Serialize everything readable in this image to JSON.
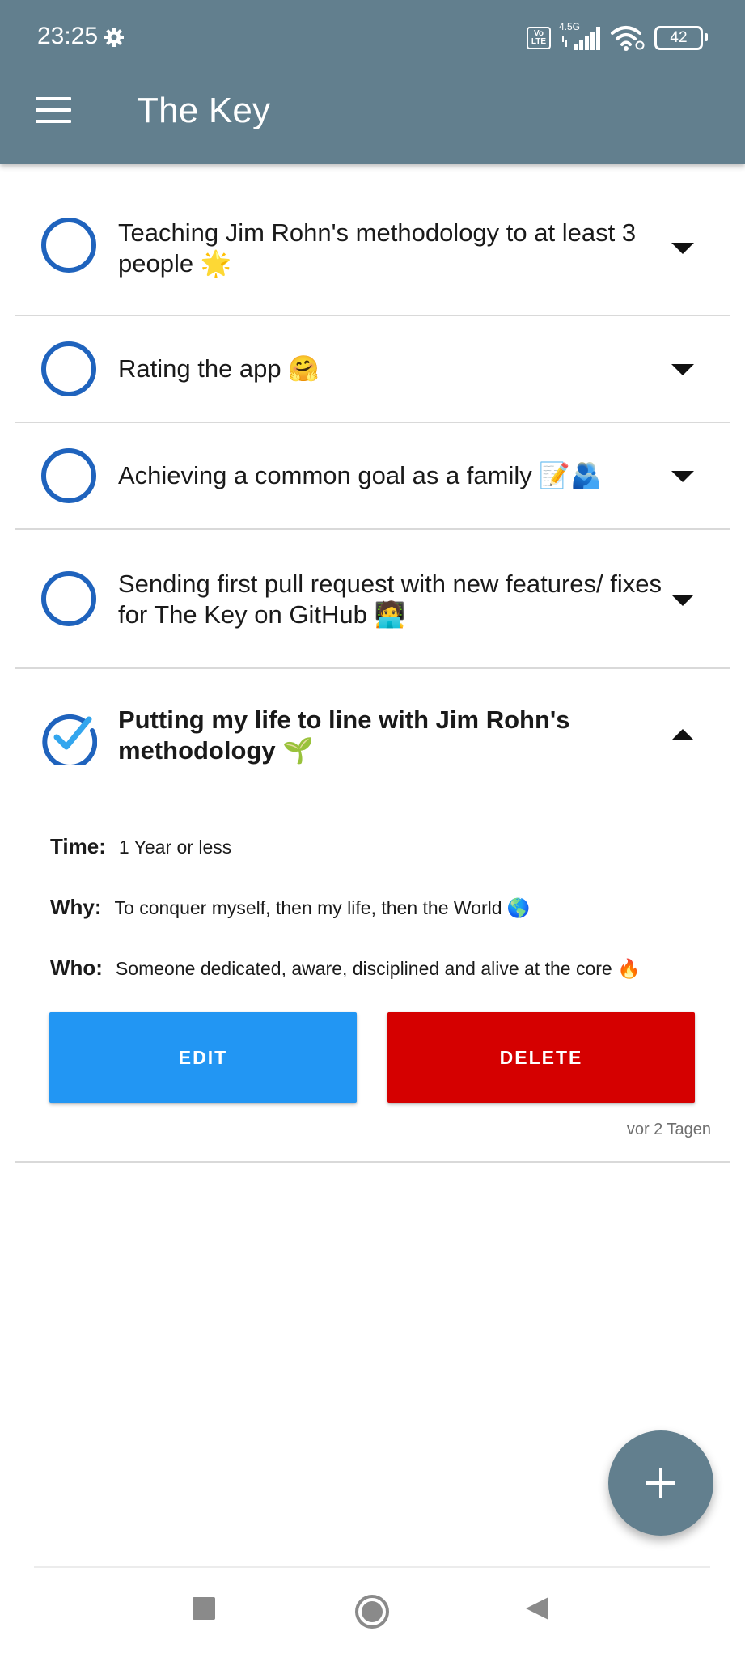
{
  "status_bar": {
    "time": "23:25",
    "network": "4.5G",
    "volte": "Vo LTE",
    "battery": "42"
  },
  "app_bar": {
    "title": "The Key"
  },
  "goals": [
    {
      "text": "Teaching Jim Rohn's methodology to at least 3 people 🌟",
      "checked": false,
      "expanded": false
    },
    {
      "text": "Rating the app 🤗",
      "checked": false,
      "expanded": false
    },
    {
      "text": "Achieving a common goal as a family 📝🫂",
      "checked": false,
      "expanded": false
    },
    {
      "text": "Sending first pull request with new features/ fixes for The Key on GitHub 🧑‍💻",
      "checked": false,
      "expanded": false
    },
    {
      "text": "Putting my life to line with Jim Rohn's methodology 🌱",
      "checked": true,
      "expanded": true
    }
  ],
  "details": {
    "time_label": "Time:",
    "time_value": "1 Year or less",
    "why_label": "Why:",
    "why_value": "To conquer myself, then my life, then the World 🌎",
    "who_label": "Who:",
    "who_value": "Someone dedicated, aware, disciplined and alive at the core 🔥",
    "edit_label": "EDIT",
    "delete_label": "DELETE",
    "timestamp": "vor 2 Tagen"
  },
  "colors": {
    "app_bar": "#627f8e",
    "circle": "#1f63bd",
    "check": "#33a6ee",
    "edit": "#2296f3",
    "delete": "#d50000"
  },
  "icons": {
    "menu": "hamburger-icon",
    "settings": "gear-icon",
    "expand": "caret-down-icon",
    "collapse": "caret-up-icon",
    "add": "plus-icon"
  }
}
